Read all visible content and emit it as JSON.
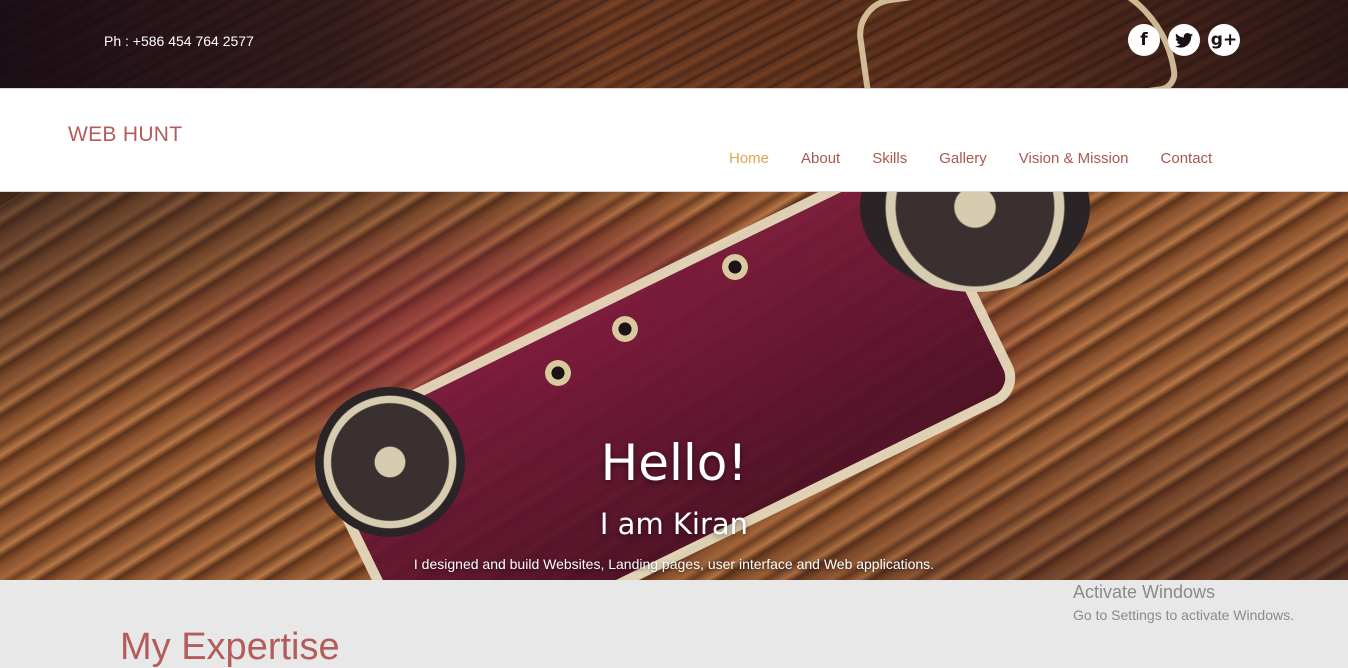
{
  "topbar": {
    "phone": "Ph : +586 454 764 2577",
    "social": [
      {
        "icon": "facebook-icon",
        "glyph": "f"
      },
      {
        "icon": "twitter-icon",
        "glyph": "🐦"
      },
      {
        "icon": "google-plus-icon",
        "glyph": "g+"
      }
    ]
  },
  "navbar": {
    "brand": "WEB HUNT",
    "items": [
      {
        "label": "Home",
        "active": true
      },
      {
        "label": "About",
        "active": false
      },
      {
        "label": "Skills",
        "active": false
      },
      {
        "label": "Gallery",
        "active": false
      },
      {
        "label": "Vision & Mission",
        "active": false
      },
      {
        "label": "Contact",
        "active": false
      }
    ]
  },
  "hero": {
    "title": "Hello!",
    "subtitle": "I am Kiran",
    "description": "I designed and build Websites, Landing pages, user interface and Web applications."
  },
  "section": {
    "heading": "My Expertise"
  },
  "watermark": {
    "line1": "Activate Windows",
    "line2": "Go to Settings to activate Windows."
  },
  "colors": {
    "brand": "#b45c5c",
    "nav_active": "#e0a54f",
    "nav_default": "#a9584f"
  }
}
